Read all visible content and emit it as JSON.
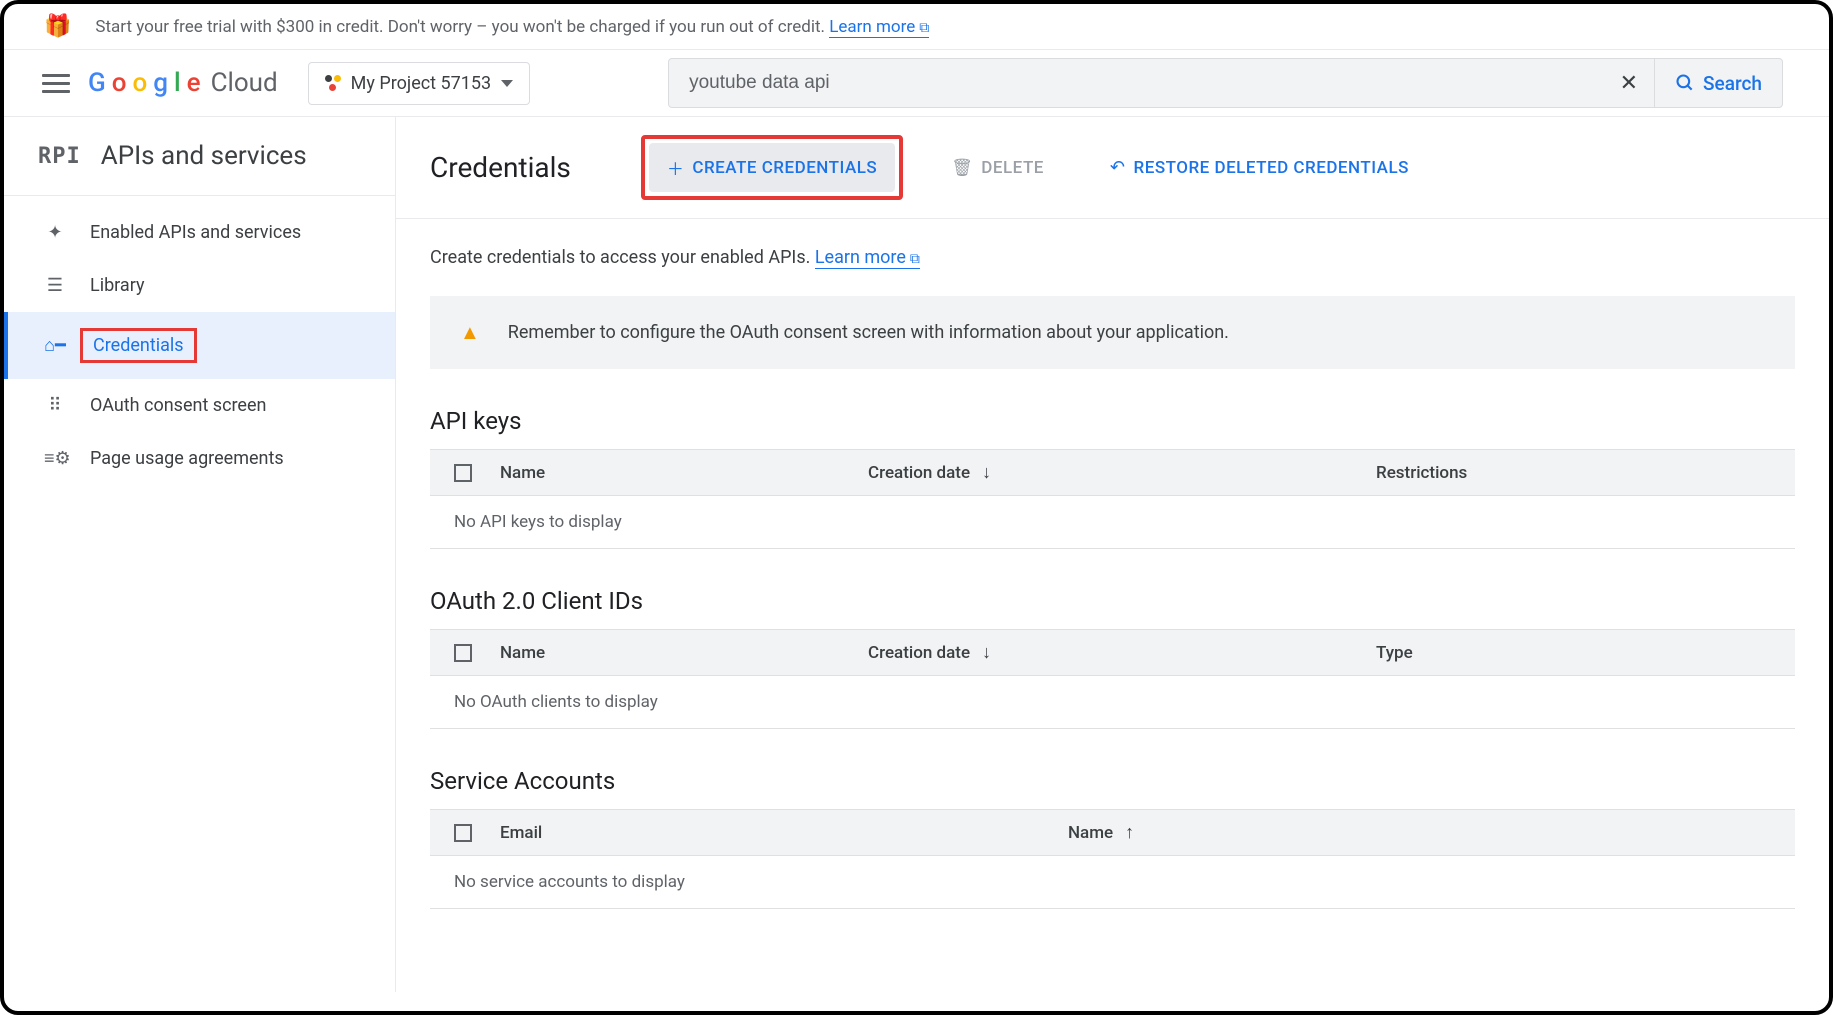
{
  "banner": {
    "text": "Start your free trial with $300 in credit. Don't worry – you won't be charged if you run out of credit.",
    "link": "Learn more"
  },
  "header": {
    "project": "My Project 57153",
    "search_value": "youtube data api",
    "search_label": "Search"
  },
  "sidebar": {
    "title": "APIs and services",
    "items": [
      {
        "label": "Enabled APIs and services"
      },
      {
        "label": "Library"
      },
      {
        "label": "Credentials"
      },
      {
        "label": "OAuth consent screen"
      },
      {
        "label": "Page usage agreements"
      }
    ]
  },
  "toolbar": {
    "title": "Credentials",
    "create": "CREATE CREDENTIALS",
    "delete": "DELETE",
    "restore": "RESTORE DELETED CREDENTIALS"
  },
  "main": {
    "desc": "Create credentials to access your enabled APIs.",
    "desc_link": "Learn more",
    "alert": "Remember to configure the OAuth consent screen with information about your application."
  },
  "sections": {
    "apikeys": {
      "title": "API keys",
      "cols": {
        "name": "Name",
        "mid": "Creation date",
        "right": "Restrictions"
      },
      "empty": "No API keys to display"
    },
    "oauth": {
      "title": "OAuth 2.0 Client IDs",
      "cols": {
        "name": "Name",
        "mid": "Creation date",
        "right": "Type"
      },
      "empty": "No OAuth clients to display"
    },
    "service": {
      "title": "Service Accounts",
      "cols": {
        "name": "Email",
        "mid": "Name",
        "right": ""
      },
      "empty": "No service accounts to display"
    }
  }
}
